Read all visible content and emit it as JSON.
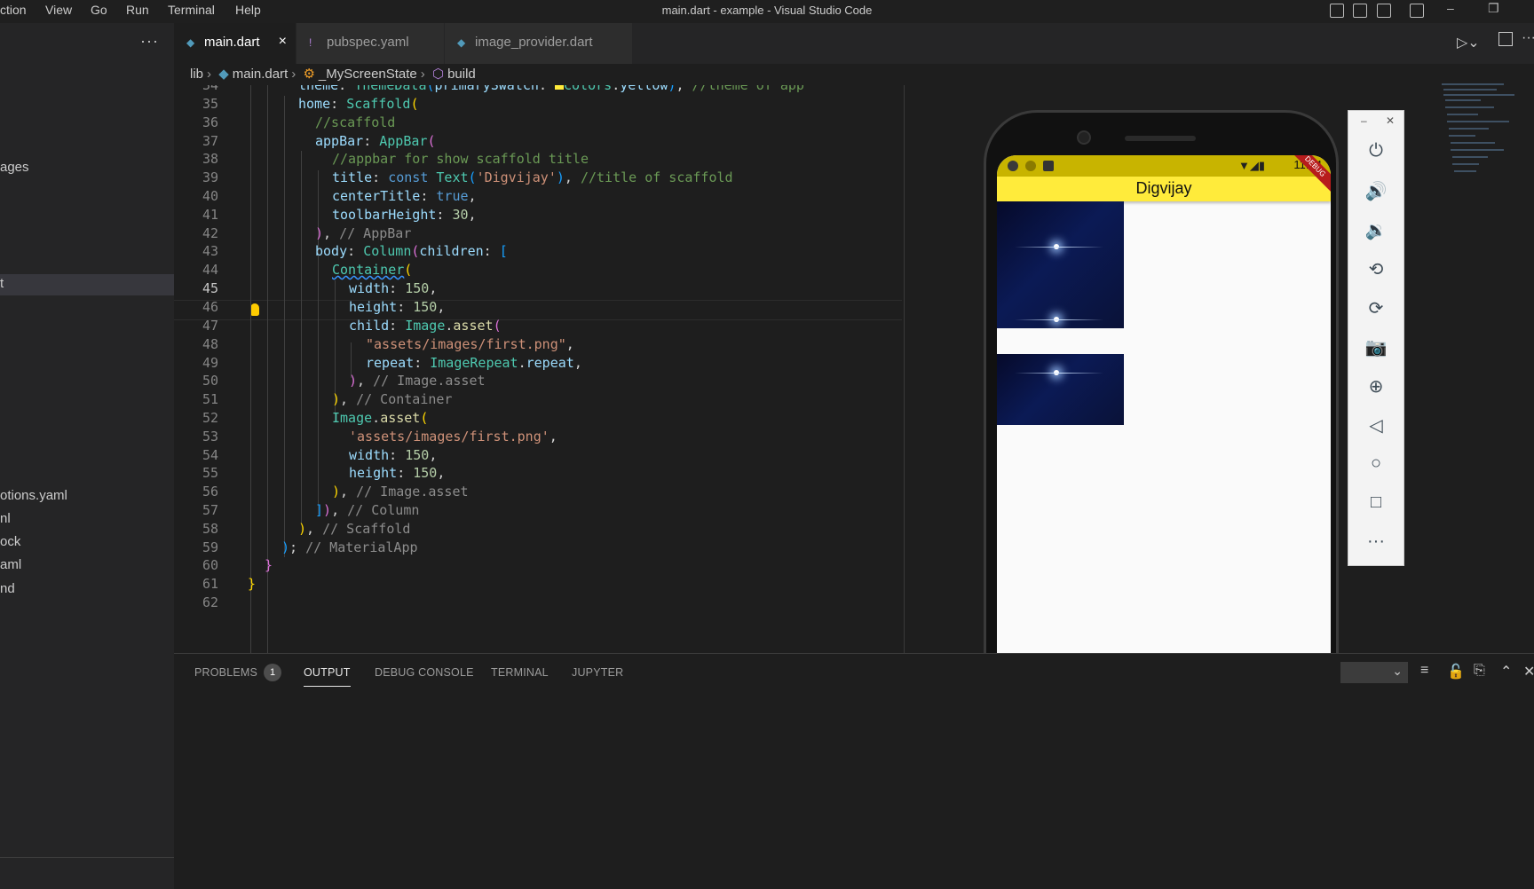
{
  "titlebar": {
    "menu": [
      "ction",
      "View",
      "Go",
      "Run",
      "Terminal",
      "Help"
    ],
    "title": "main.dart - example - Visual Studio Code"
  },
  "sidebar": {
    "more": "···",
    "items": [
      "ages",
      "t",
      "otions.yaml",
      "nl",
      "ock",
      "aml",
      "nd"
    ]
  },
  "tabs": [
    {
      "label": "main.dart",
      "icon": "dart-icon",
      "close": "×"
    },
    {
      "label": "pubspec.yaml",
      "icon": "!"
    },
    {
      "label": "image_provider.dart",
      "icon": "dart-icon"
    }
  ],
  "breadcrumb": {
    "lib": "lib",
    "file": "main.dart",
    "class": "_MyScreenState",
    "method": "build"
  },
  "editor": {
    "current_line": 45,
    "line_numbers": [
      "34",
      "35",
      "36",
      "37",
      "38",
      "39",
      "40",
      "41",
      "42",
      "43",
      "44",
      "45",
      "46",
      "47",
      "48",
      "49",
      "50",
      "51",
      "52",
      "53",
      "54",
      "55",
      "56",
      "57",
      "58",
      "59",
      "60",
      "61",
      "62"
    ]
  },
  "panel": {
    "tabs": [
      "PROBLEMS",
      "OUTPUT",
      "DEBUG CONSOLE",
      "TERMINAL",
      "JUPYTER"
    ],
    "problems_count": "1",
    "active_tab": "OUTPUT"
  },
  "emulator": {
    "app_title": "Digvijay",
    "clock": "11:14",
    "debug_banner": "DEBUG"
  },
  "colors": {
    "appbar": "#ffeb3b",
    "statusbar": "#c8b400",
    "editor_bg": "#1e1e1e"
  }
}
